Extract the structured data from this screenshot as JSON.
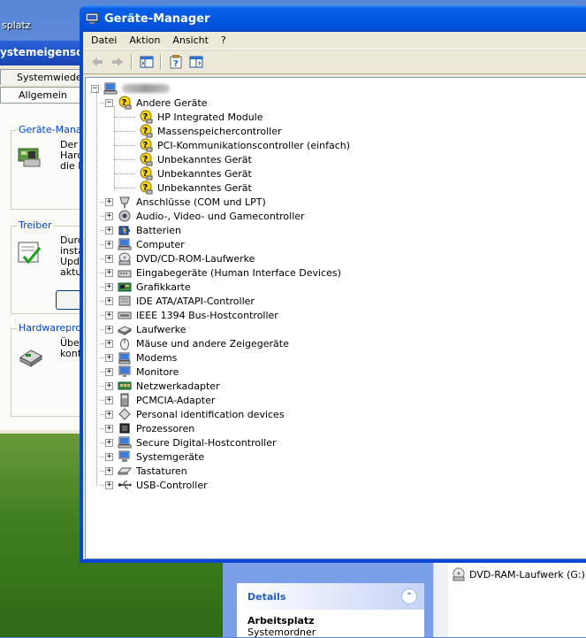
{
  "desktop": {
    "icon_label": "splatz"
  },
  "system_properties": {
    "title": "ystemeigensch",
    "tabs": [
      "Systemwiederh",
      "Allgemein"
    ],
    "groups": [
      {
        "label": "Geräte-Manage",
        "text": "Der l\nHard\ndie E"
      },
      {
        "label": "Treiber",
        "text": "Durc\ninsta\nUpda\naktu"
      },
      {
        "label": "Hardwareprofile",
        "text": "Über\nkonf"
      }
    ]
  },
  "explorer_behind": {
    "details_title": "Details",
    "details_name": "Arbeitsplatz",
    "details_sub": "Systemordner",
    "drive_label": "DVD-RAM-Laufwerk (G:)"
  },
  "window": {
    "title": "Geräte-Manager",
    "menu": [
      "Datei",
      "Aktion",
      "Ansicht",
      "?"
    ]
  },
  "tree": {
    "root_name_redacted": true,
    "categories": [
      {
        "label": "Andere Geräte",
        "icon": "question-device-icon",
        "expanded": true,
        "children": [
          "HP Integrated Module",
          "Massenspeichercontroller",
          "PCI-Kommunikationscontroller (einfach)",
          "Unbekanntes Gerät",
          "Unbekanntes Gerät",
          "Unbekanntes Gerät"
        ]
      },
      {
        "label": "Anschlüsse (COM und LPT)",
        "icon": "port-icon"
      },
      {
        "label": "Audio-, Video- und Gamecontroller",
        "icon": "audio-icon"
      },
      {
        "label": "Batterien",
        "icon": "battery-icon"
      },
      {
        "label": "Computer",
        "icon": "computer-icon"
      },
      {
        "label": "DVD/CD-ROM-Laufwerke",
        "icon": "cdrom-icon"
      },
      {
        "label": "Eingabegeräte (Human Interface Devices)",
        "icon": "hid-icon"
      },
      {
        "label": "Grafikkarte",
        "icon": "display-adapter-icon"
      },
      {
        "label": "IDE ATA/ATAPI-Controller",
        "icon": "ide-icon"
      },
      {
        "label": "IEEE 1394 Bus-Hostcontroller",
        "icon": "firewire-icon"
      },
      {
        "label": "Laufwerke",
        "icon": "disk-drive-icon"
      },
      {
        "label": "Mäuse und andere Zeigegeräte",
        "icon": "mouse-icon"
      },
      {
        "label": "Modems",
        "icon": "modem-icon"
      },
      {
        "label": "Monitore",
        "icon": "monitor-icon"
      },
      {
        "label": "Netzwerkadapter",
        "icon": "network-adapter-icon"
      },
      {
        "label": "PCMCIA-Adapter",
        "icon": "pcmcia-icon"
      },
      {
        "label": "Personal identification devices",
        "icon": "pid-icon"
      },
      {
        "label": "Prozessoren",
        "icon": "processor-icon"
      },
      {
        "label": "Secure Digital-Hostcontroller",
        "icon": "sd-host-icon"
      },
      {
        "label": "Systemgeräte",
        "icon": "system-device-icon"
      },
      {
        "label": "Tastaturen",
        "icon": "keyboard-icon"
      },
      {
        "label": "USB-Controller",
        "icon": "usb-icon"
      }
    ]
  },
  "colors": {
    "title_bar": "#0058e4",
    "window_frame": "#0a47d6",
    "client_bg": "#ece9d8",
    "group_label": "#0046d5"
  }
}
